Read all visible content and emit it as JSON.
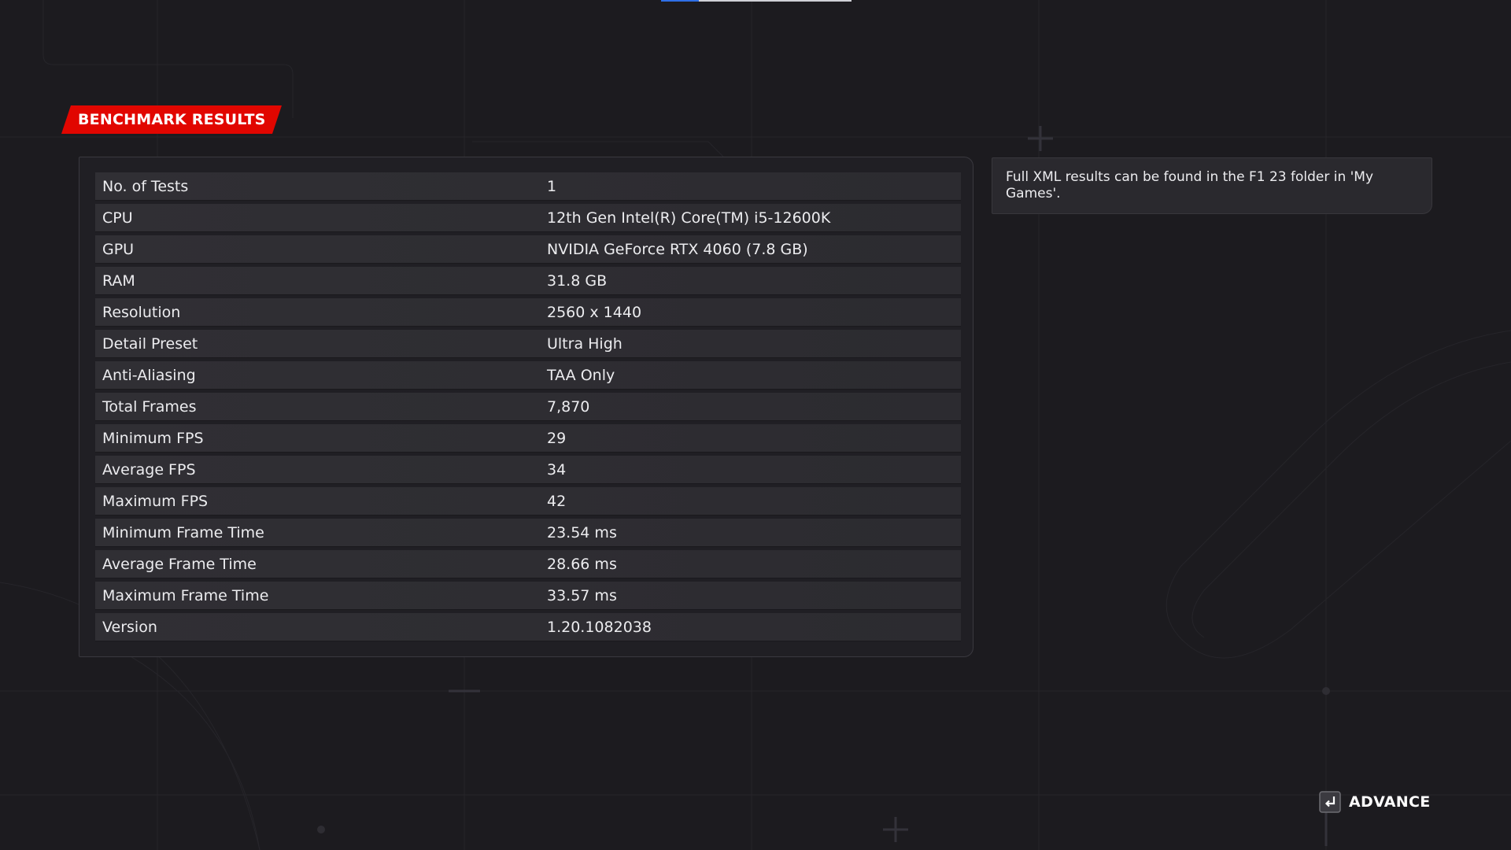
{
  "screen": {
    "title": "BENCHMARK RESULTS",
    "top_progress_fraction": 0.2,
    "accent_color": "#e10600",
    "background_color": "#1c1b1f"
  },
  "results": {
    "rows": [
      {
        "label": "No. of Tests",
        "value": "1"
      },
      {
        "label": "CPU",
        "value": "12th Gen Intel(R) Core(TM) i5-12600K"
      },
      {
        "label": "GPU",
        "value": "NVIDIA GeForce RTX 4060 (7.8 GB)"
      },
      {
        "label": "RAM",
        "value": "31.8 GB"
      },
      {
        "label": "Resolution",
        "value": "2560 x 1440"
      },
      {
        "label": "Detail Preset",
        "value": "Ultra High"
      },
      {
        "label": "Anti-Aliasing",
        "value": "TAA Only"
      },
      {
        "label": "Total Frames",
        "value": "7,870"
      },
      {
        "label": "Minimum FPS",
        "value": "29"
      },
      {
        "label": "Average FPS",
        "value": "34"
      },
      {
        "label": "Maximum FPS",
        "value": "42"
      },
      {
        "label": "Minimum Frame Time",
        "value": "23.54 ms"
      },
      {
        "label": "Average Frame Time",
        "value": "28.66 ms"
      },
      {
        "label": "Maximum Frame Time",
        "value": "33.57 ms"
      },
      {
        "label": "Version",
        "value": "1.20.1082038"
      }
    ]
  },
  "info": {
    "text": "Full XML results can be found in the F1 23 folder in 'My Games'."
  },
  "footer": {
    "advance_label": "ADVANCE",
    "advance_icon": "enter-key-icon"
  }
}
